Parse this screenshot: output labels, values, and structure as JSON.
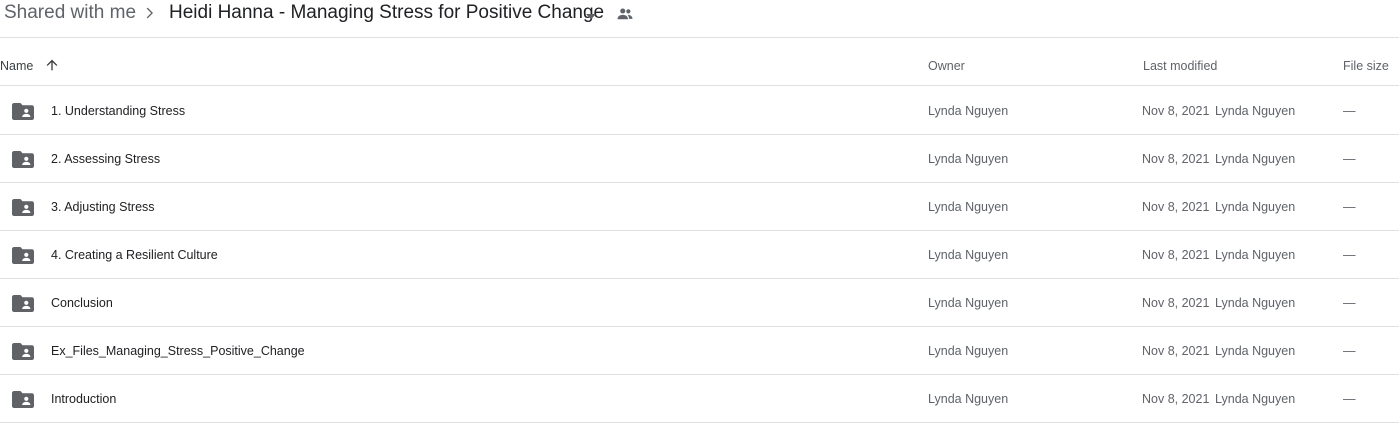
{
  "breadcrumb": {
    "root": "Shared with me",
    "separator_icon": "chevron-right-icon",
    "current": "Heidi Hanna - Managing Stress for Positive Change",
    "dropdown_icon": "arrow-drop-down-icon",
    "shared_icon": "people-icon"
  },
  "columns": {
    "name": "Name",
    "sort_icon": "arrow-upward-icon",
    "owner": "Owner",
    "last_modified": "Last modified",
    "file_size": "File size"
  },
  "colors": {
    "folder_icon": "#5f6368",
    "divider": "#e0e0e0",
    "secondary_text": "#5f6368"
  },
  "files": [
    {
      "name": "1. Understanding Stress",
      "owner": "Lynda Nguyen",
      "modified_date": "Nov 8, 2021",
      "modified_by": "Lynda Nguyen",
      "size": "—",
      "icon": "shared-folder-icon"
    },
    {
      "name": "2. Assessing Stress",
      "owner": "Lynda Nguyen",
      "modified_date": "Nov 8, 2021",
      "modified_by": "Lynda Nguyen",
      "size": "—",
      "icon": "shared-folder-icon"
    },
    {
      "name": "3. Adjusting Stress",
      "owner": "Lynda Nguyen",
      "modified_date": "Nov 8, 2021",
      "modified_by": "Lynda Nguyen",
      "size": "—",
      "icon": "shared-folder-icon"
    },
    {
      "name": "4. Creating a Resilient Culture",
      "owner": "Lynda Nguyen",
      "modified_date": "Nov 8, 2021",
      "modified_by": "Lynda Nguyen",
      "size": "—",
      "icon": "shared-folder-icon"
    },
    {
      "name": "Conclusion",
      "owner": "Lynda Nguyen",
      "modified_date": "Nov 8, 2021",
      "modified_by": "Lynda Nguyen",
      "size": "—",
      "icon": "shared-folder-icon"
    },
    {
      "name": "Ex_Files_Managing_Stress_Positive_Change",
      "owner": "Lynda Nguyen",
      "modified_date": "Nov 8, 2021",
      "modified_by": "Lynda Nguyen",
      "size": "—",
      "icon": "shared-folder-icon"
    },
    {
      "name": "Introduction",
      "owner": "Lynda Nguyen",
      "modified_date": "Nov 8, 2021",
      "modified_by": "Lynda Nguyen",
      "size": "—",
      "icon": "shared-folder-icon"
    }
  ]
}
